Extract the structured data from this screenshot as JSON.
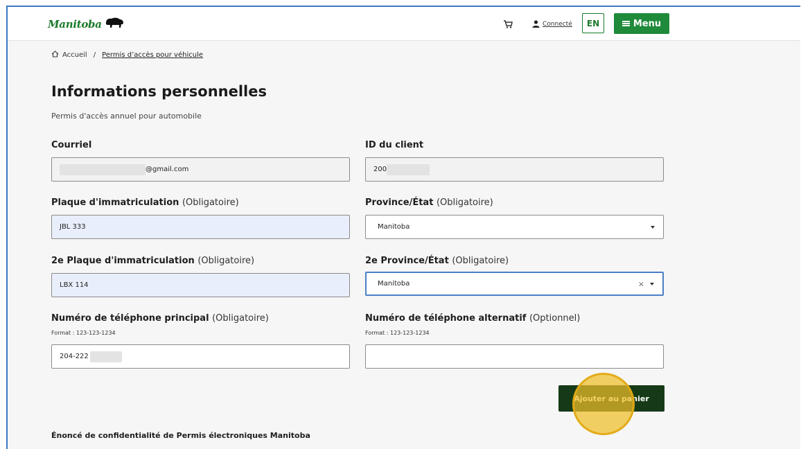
{
  "header": {
    "logo_text": "Manitoba",
    "logo_icon": "bison-icon",
    "cart_icon": "cart-icon",
    "user_icon": "user-icon",
    "user_link": "Connecté",
    "lang_button": "EN",
    "menu_button": "Menu",
    "menu_icon": "hamburger-icon"
  },
  "breadcrumb": {
    "home_icon": "home-icon",
    "home": "Accueil",
    "separator": "/",
    "current": "Permis d’accès pour véhicule"
  },
  "page": {
    "title": "Informations personnelles",
    "subtitle": "Permis d'accès annuel pour automobile"
  },
  "form": {
    "email": {
      "label": "Courriel",
      "value": "@gmail.com"
    },
    "client_id": {
      "label": "ID du client",
      "value": "200"
    },
    "plate": {
      "label": "Plaque d'immatriculation",
      "req": "(Obligatoire)",
      "value": "JBL 333"
    },
    "province": {
      "label": "Province/État",
      "req": "(Obligatoire)",
      "value": "Manitoba"
    },
    "plate2": {
      "label": "2e Plaque d'immatriculation",
      "req": "(Obligatoire)",
      "value": "LBX 114"
    },
    "province2": {
      "label": "2e Province/État",
      "req": "(Obligatoire)",
      "value": "Manitoba",
      "clear": "×"
    },
    "phone": {
      "label": "Numéro de téléphone principal",
      "req": "(Obligatoire)",
      "hint": "Format : 123-123-1234",
      "value": "204-222"
    },
    "phone_alt": {
      "label": "Numéro de téléphone alternatif",
      "req": "(Optionnel)",
      "hint": "Format : 123-123-1234",
      "value": ""
    },
    "submit": "Ajouter au panier"
  },
  "footer": {
    "privacy": "Énoncé de confidentialité de Permis électroniques Manitoba"
  },
  "colors": {
    "brand_green": "#1b7a2b",
    "menu_green": "#1f8a3a",
    "submit_dark": "#163a17",
    "focus_blue": "#4a7fc7",
    "filled_input": "#e8eefb",
    "cursor_highlight": "#eebe28"
  }
}
